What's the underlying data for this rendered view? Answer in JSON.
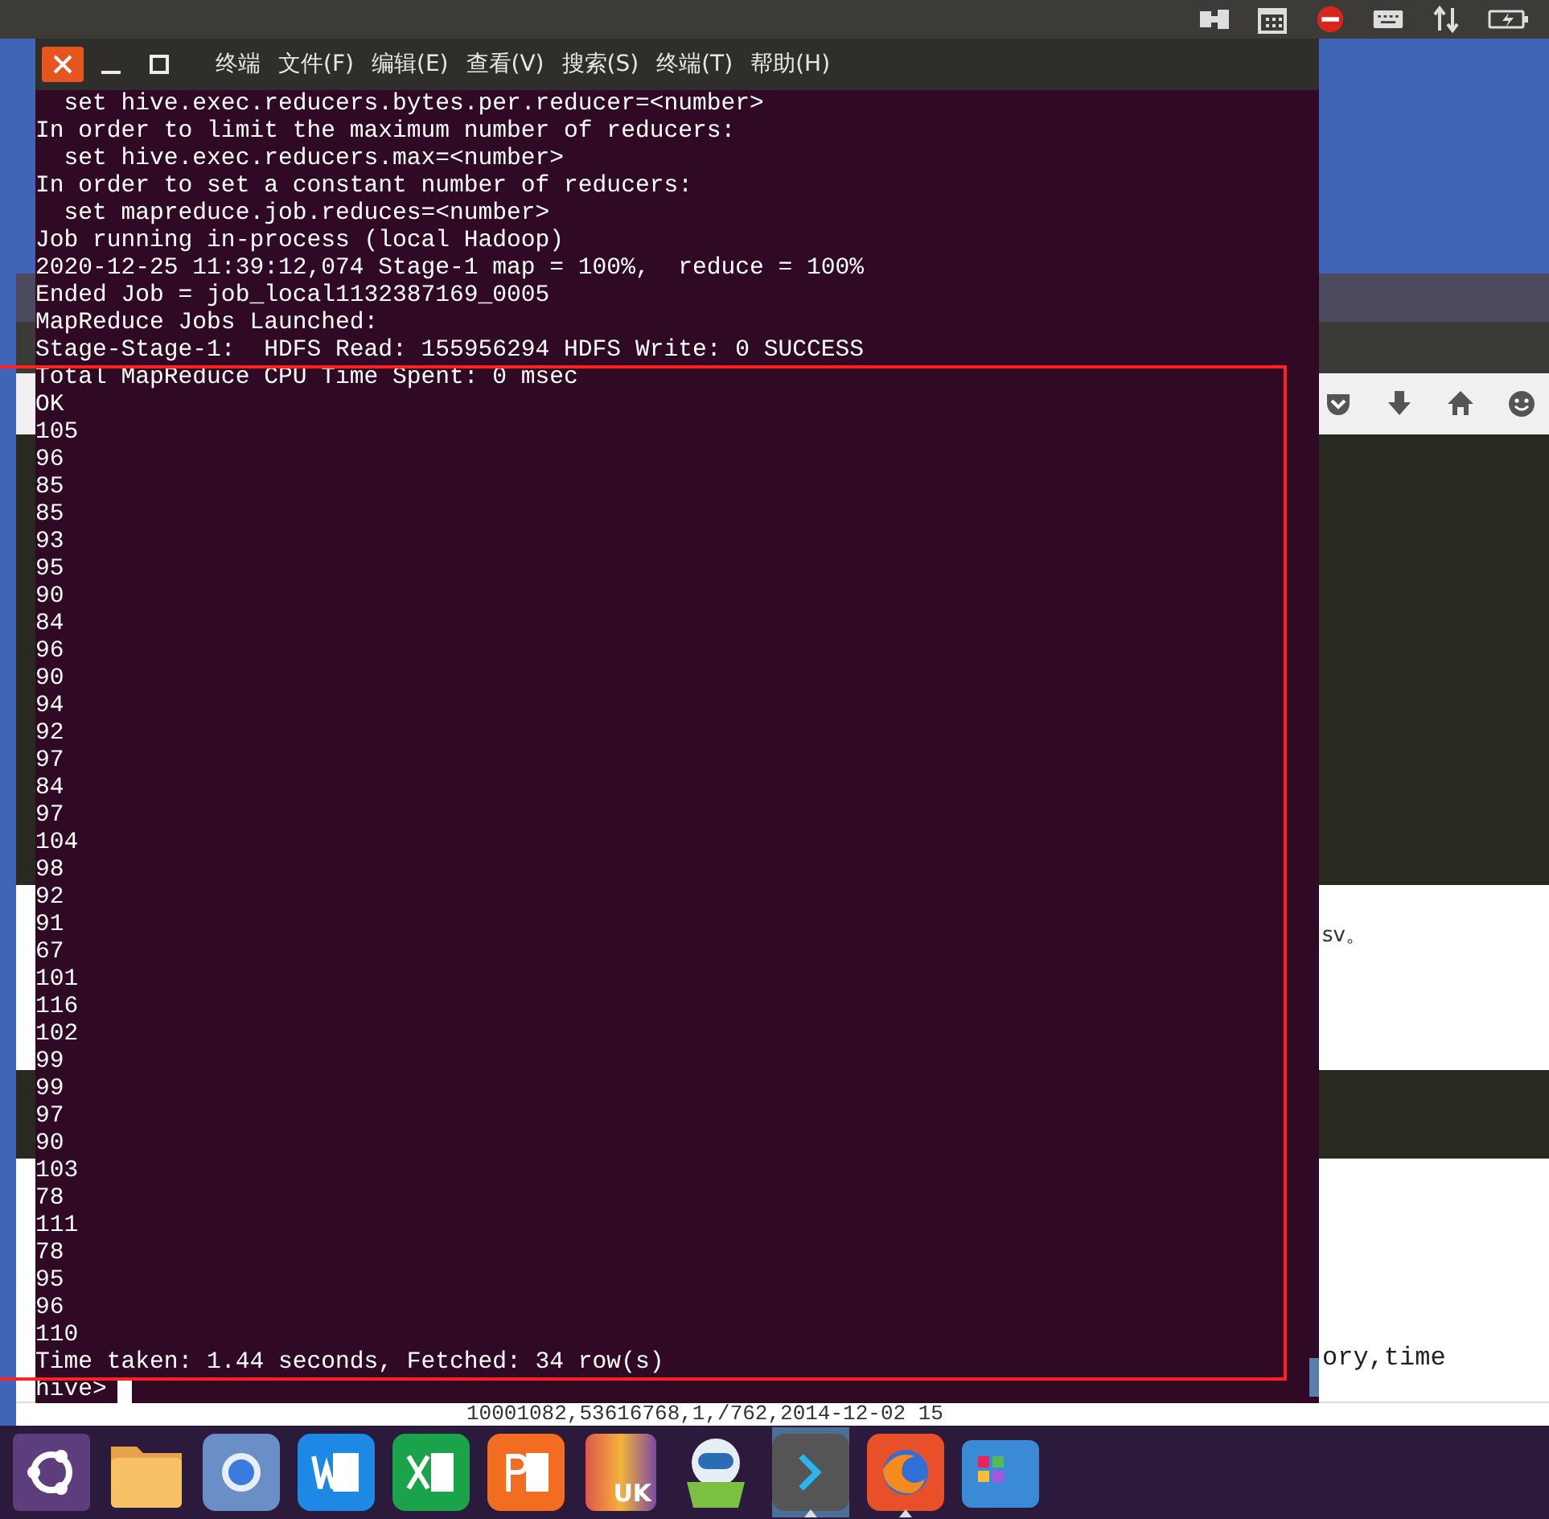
{
  "top_panel": {
    "icons": [
      {
        "kind": "toggle"
      },
      {
        "kind": "calendar"
      },
      {
        "kind": "stop"
      },
      {
        "kind": "keyboard"
      },
      {
        "kind": "network"
      },
      {
        "kind": "battery"
      }
    ]
  },
  "browser_window": {
    "texts": [
      {
        "kind": "note",
        "text": "sv。"
      },
      {
        "kind": "code",
        "text": "ory,time"
      },
      {
        "kind": "bottom",
        "text": "10001082,53616768,1,/762,2014-12-02 15"
      }
    ]
  },
  "terminal": {
    "menu": [
      "终端",
      "文件(F)",
      "编辑(E)",
      "查看(V)",
      "搜索(S)",
      "终端(T)",
      "帮助(H)"
    ],
    "lines": [
      "  set hive.exec.reducers.bytes.per.reducer=<number>",
      "In order to limit the maximum number of reducers:",
      "  set hive.exec.reducers.max=<number>",
      "In order to set a constant number of reducers:",
      "  set mapreduce.job.reduces=<number>",
      "Job running in-process (local Hadoop)",
      "2020-12-25 11:39:12,074 Stage-1 map = 100%,  reduce = 100%",
      "Ended Job = job_local1132387169_0005",
      "MapReduce Jobs Launched:",
      "Stage-Stage-1:  HDFS Read: 155956294 HDFS Write: 0 SUCCESS",
      "Total MapReduce CPU Time Spent: 0 msec",
      "OK",
      "105",
      "96",
      "85",
      "85",
      "93",
      "95",
      "90",
      "84",
      "96",
      "90",
      "94",
      "92",
      "97",
      "84",
      "97",
      "104",
      "98",
      "92",
      "91",
      "67",
      "101",
      "116",
      "102",
      "99",
      "99",
      "97",
      "90",
      "103",
      "78",
      "111",
      "78",
      "95",
      "96",
      "110",
      "Time taken: 1.44 seconds, Fetched: 34 row(s)"
    ],
    "prompt": "hive>"
  },
  "dock": [
    {
      "kind": "ubuntu",
      "selected": false,
      "running": false
    },
    {
      "kind": "folder",
      "selected": false,
      "running": false
    },
    {
      "kind": "browser",
      "selected": false,
      "running": false
    },
    {
      "kind": "word",
      "selected": false,
      "running": false
    },
    {
      "kind": "excel",
      "selected": false,
      "running": false
    },
    {
      "kind": "powerpoint",
      "selected": false,
      "running": false
    },
    {
      "kind": "bag",
      "label": "UK",
      "selected": false,
      "running": false
    },
    {
      "kind": "robot",
      "selected": false,
      "running": false
    },
    {
      "kind": "terminal",
      "selected": true,
      "running": true
    },
    {
      "kind": "fox",
      "selected": false,
      "running": true
    },
    {
      "kind": "apps",
      "selected": false,
      "running": false
    }
  ]
}
